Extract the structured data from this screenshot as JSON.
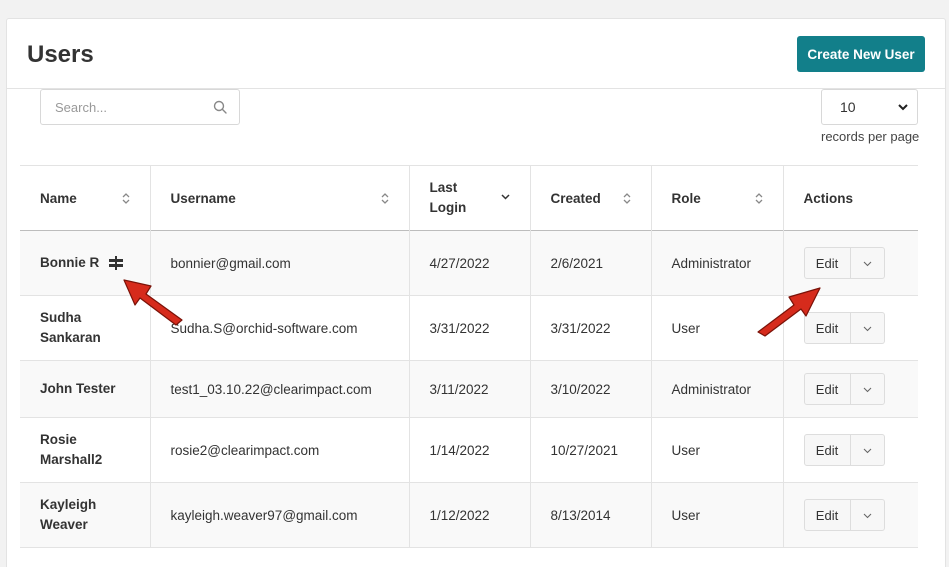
{
  "header": {
    "title": "Users",
    "create_button": "Create New User"
  },
  "search": {
    "placeholder": "Search..."
  },
  "pagination": {
    "per_page_value": "10",
    "per_page_label": "records per page"
  },
  "table": {
    "columns": [
      {
        "label": "Name",
        "sort": "sortable"
      },
      {
        "label": "Username",
        "sort": "sortable"
      },
      {
        "label": "Last Login",
        "sort": "descending"
      },
      {
        "label": "Created",
        "sort": "sortable"
      },
      {
        "label": "Role",
        "sort": "sortable"
      },
      {
        "label": "Actions",
        "sort": "none"
      }
    ],
    "rows": [
      {
        "name": "Bonnie R",
        "username": "bonnier@gmail.com",
        "last_login": "4/27/2022",
        "created": "2/6/2021",
        "role": "Administrator",
        "edit_label": "Edit",
        "badge_icon": "signpost-icon"
      },
      {
        "name": "Sudha Sankaran",
        "username": "Sudha.S@orchid-software.com",
        "last_login": "3/31/2022",
        "created": "3/31/2022",
        "role": "User",
        "edit_label": "Edit"
      },
      {
        "name": "John Tester",
        "username": "test1_03.10.22@clearimpact.com",
        "last_login": "3/11/2022",
        "created": "3/10/2022",
        "role": "Administrator",
        "edit_label": "Edit"
      },
      {
        "name": "Rosie Marshall2",
        "username": "rosie2@clearimpact.com",
        "last_login": "1/14/2022",
        "created": "10/27/2021",
        "role": "User",
        "edit_label": "Edit"
      },
      {
        "name": "Kayleigh Weaver",
        "username": "kayleigh.weaver97@gmail.com",
        "last_login": "1/12/2022",
        "created": "8/13/2014",
        "role": "User",
        "edit_label": "Edit"
      }
    ]
  },
  "colors": {
    "primary_button": "#127f8a",
    "annotation_arrow": "#d62b1c"
  }
}
